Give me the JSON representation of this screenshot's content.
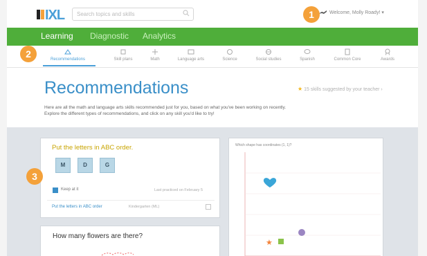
{
  "header": {
    "logo_text": "IXL",
    "search_placeholder": "Search topics and skills",
    "welcome": "Welcome, Molly Roady! ▾"
  },
  "nav": {
    "main": [
      "Learning",
      "Diagnostic",
      "Analytics"
    ],
    "sub": [
      "Recommendations",
      "Skill plans",
      "Math",
      "Language arts",
      "Science",
      "Social studies",
      "Spanish",
      "Common Core",
      "Awards"
    ]
  },
  "badges": [
    "1",
    "2",
    "3"
  ],
  "page": {
    "title": "Recommendations",
    "teacher_note": "15 skills suggested by your teacher ›",
    "intro_line1": "Here are all the math and language arts skills recommended just for you, based on what you've been working on recently.",
    "intro_line2": "Explore the different types of recommendations, and click on any skill you'd like to try!"
  },
  "card1": {
    "title": "Put the letters in ABC order.",
    "tiles": [
      "M",
      "D",
      "G"
    ],
    "keep": "Keep at it",
    "practiced": "Last practiced on February 5",
    "skill_link": "Put the letters in ABC order",
    "grade": "Kindergarten (ML)"
  },
  "card2": {
    "title": "How many flowers are there?"
  },
  "card3": {
    "title": "Which shape has coordinates (1, 1)?"
  },
  "colors": {
    "accent": "#4a9fd8",
    "nav_green": "#4fae3a",
    "badge": "#f4a13a"
  },
  "icons": [
    "search-icon",
    "user-icon",
    "star-icon",
    "heart-icon",
    "circle-icon",
    "square-icon"
  ]
}
